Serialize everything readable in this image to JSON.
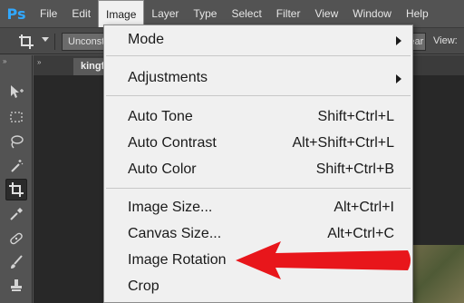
{
  "app": {
    "logo": "Ps"
  },
  "menubar": {
    "items": [
      "File",
      "Edit",
      "Image",
      "Layer",
      "Type",
      "Select",
      "Filter",
      "View",
      "Window",
      "Help"
    ]
  },
  "options": {
    "ratio_select": "Unconstrained",
    "right_button": "Clear",
    "view_label": "View:"
  },
  "document": {
    "tab_title": "kingfisher.jpg"
  },
  "image_menu": {
    "items": [
      {
        "label": "Mode",
        "shortcut": "",
        "submenu": true
      },
      {
        "label": "Adjustments",
        "shortcut": "",
        "submenu": true
      },
      {
        "label": "Auto Tone",
        "shortcut": "Shift+Ctrl+L",
        "submenu": false
      },
      {
        "label": "Auto Contrast",
        "shortcut": "Alt+Shift+Ctrl+L",
        "submenu": false
      },
      {
        "label": "Auto Color",
        "shortcut": "Shift+Ctrl+B",
        "submenu": false
      },
      {
        "label": "Image Size...",
        "shortcut": "Alt+Ctrl+I",
        "submenu": false
      },
      {
        "label": "Canvas Size...",
        "shortcut": "Alt+Ctrl+C",
        "submenu": false
      },
      {
        "label": "Image Rotation",
        "shortcut": "",
        "submenu": true
      },
      {
        "label": "Crop",
        "shortcut": "",
        "submenu": false
      }
    ]
  },
  "annotation": {
    "arrow_color": "#e8161b",
    "points_to": "Image Rotation"
  },
  "tools": [
    "move-tool",
    "marquee-tool",
    "lasso-tool",
    "magic-wand-tool",
    "crop-tool",
    "eyedropper-tool",
    "healing-brush-tool",
    "brush-tool",
    "clone-stamp-tool",
    "history-brush-tool"
  ]
}
